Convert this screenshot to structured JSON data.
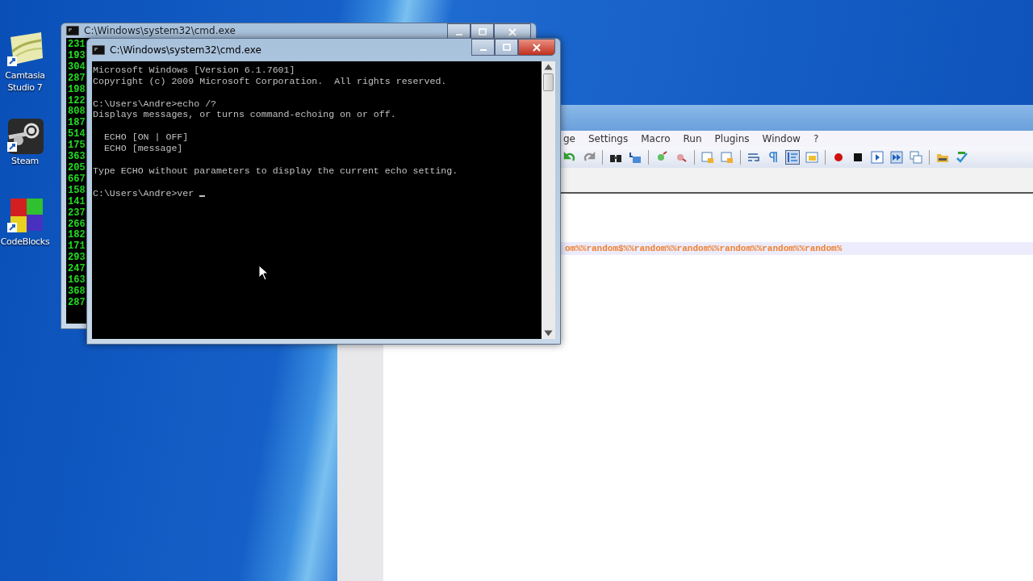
{
  "desktop_icons": [
    {
      "label": "Camtasia Studio 7",
      "kind": "camtasia"
    },
    {
      "label": "Steam",
      "kind": "steam"
    },
    {
      "label": "CodeBlocks",
      "kind": "blocks"
    }
  ],
  "editor_window": {
    "menu": [
      "ge",
      "Settings",
      "Macro",
      "Run",
      "Plugins",
      "Window",
      "?"
    ],
    "code_line": "om%%random$%%random%%random%%random%%random%%random%"
  },
  "back_console": {
    "title": "C:\\Windows\\system32\\cmd.exe",
    "lines": [
      "231",
      "193",
      "304",
      "287",
      "198",
      "122",
      "808",
      "187",
      "514",
      "175",
      "363",
      "205",
      "667",
      "158",
      "141",
      "237",
      "266",
      "182",
      "171",
      "293",
      "247",
      "163",
      "368",
      "287"
    ]
  },
  "front_console": {
    "title": "C:\\Windows\\system32\\cmd.exe",
    "blocks": [
      [
        "Microsoft Windows [Version 6.1.7601]",
        "Copyright (c) 2009 Microsoft Corporation.  All rights reserved."
      ],
      [
        "C:\\Users\\Andre>echo /?",
        "Displays messages, or turns command-echoing on or off."
      ],
      [
        "  ECHO [ON | OFF]",
        "  ECHO [message]"
      ],
      [
        "Type ECHO without parameters to display the current echo setting."
      ],
      [
        "C:\\Users\\Andre>ver "
      ]
    ]
  }
}
